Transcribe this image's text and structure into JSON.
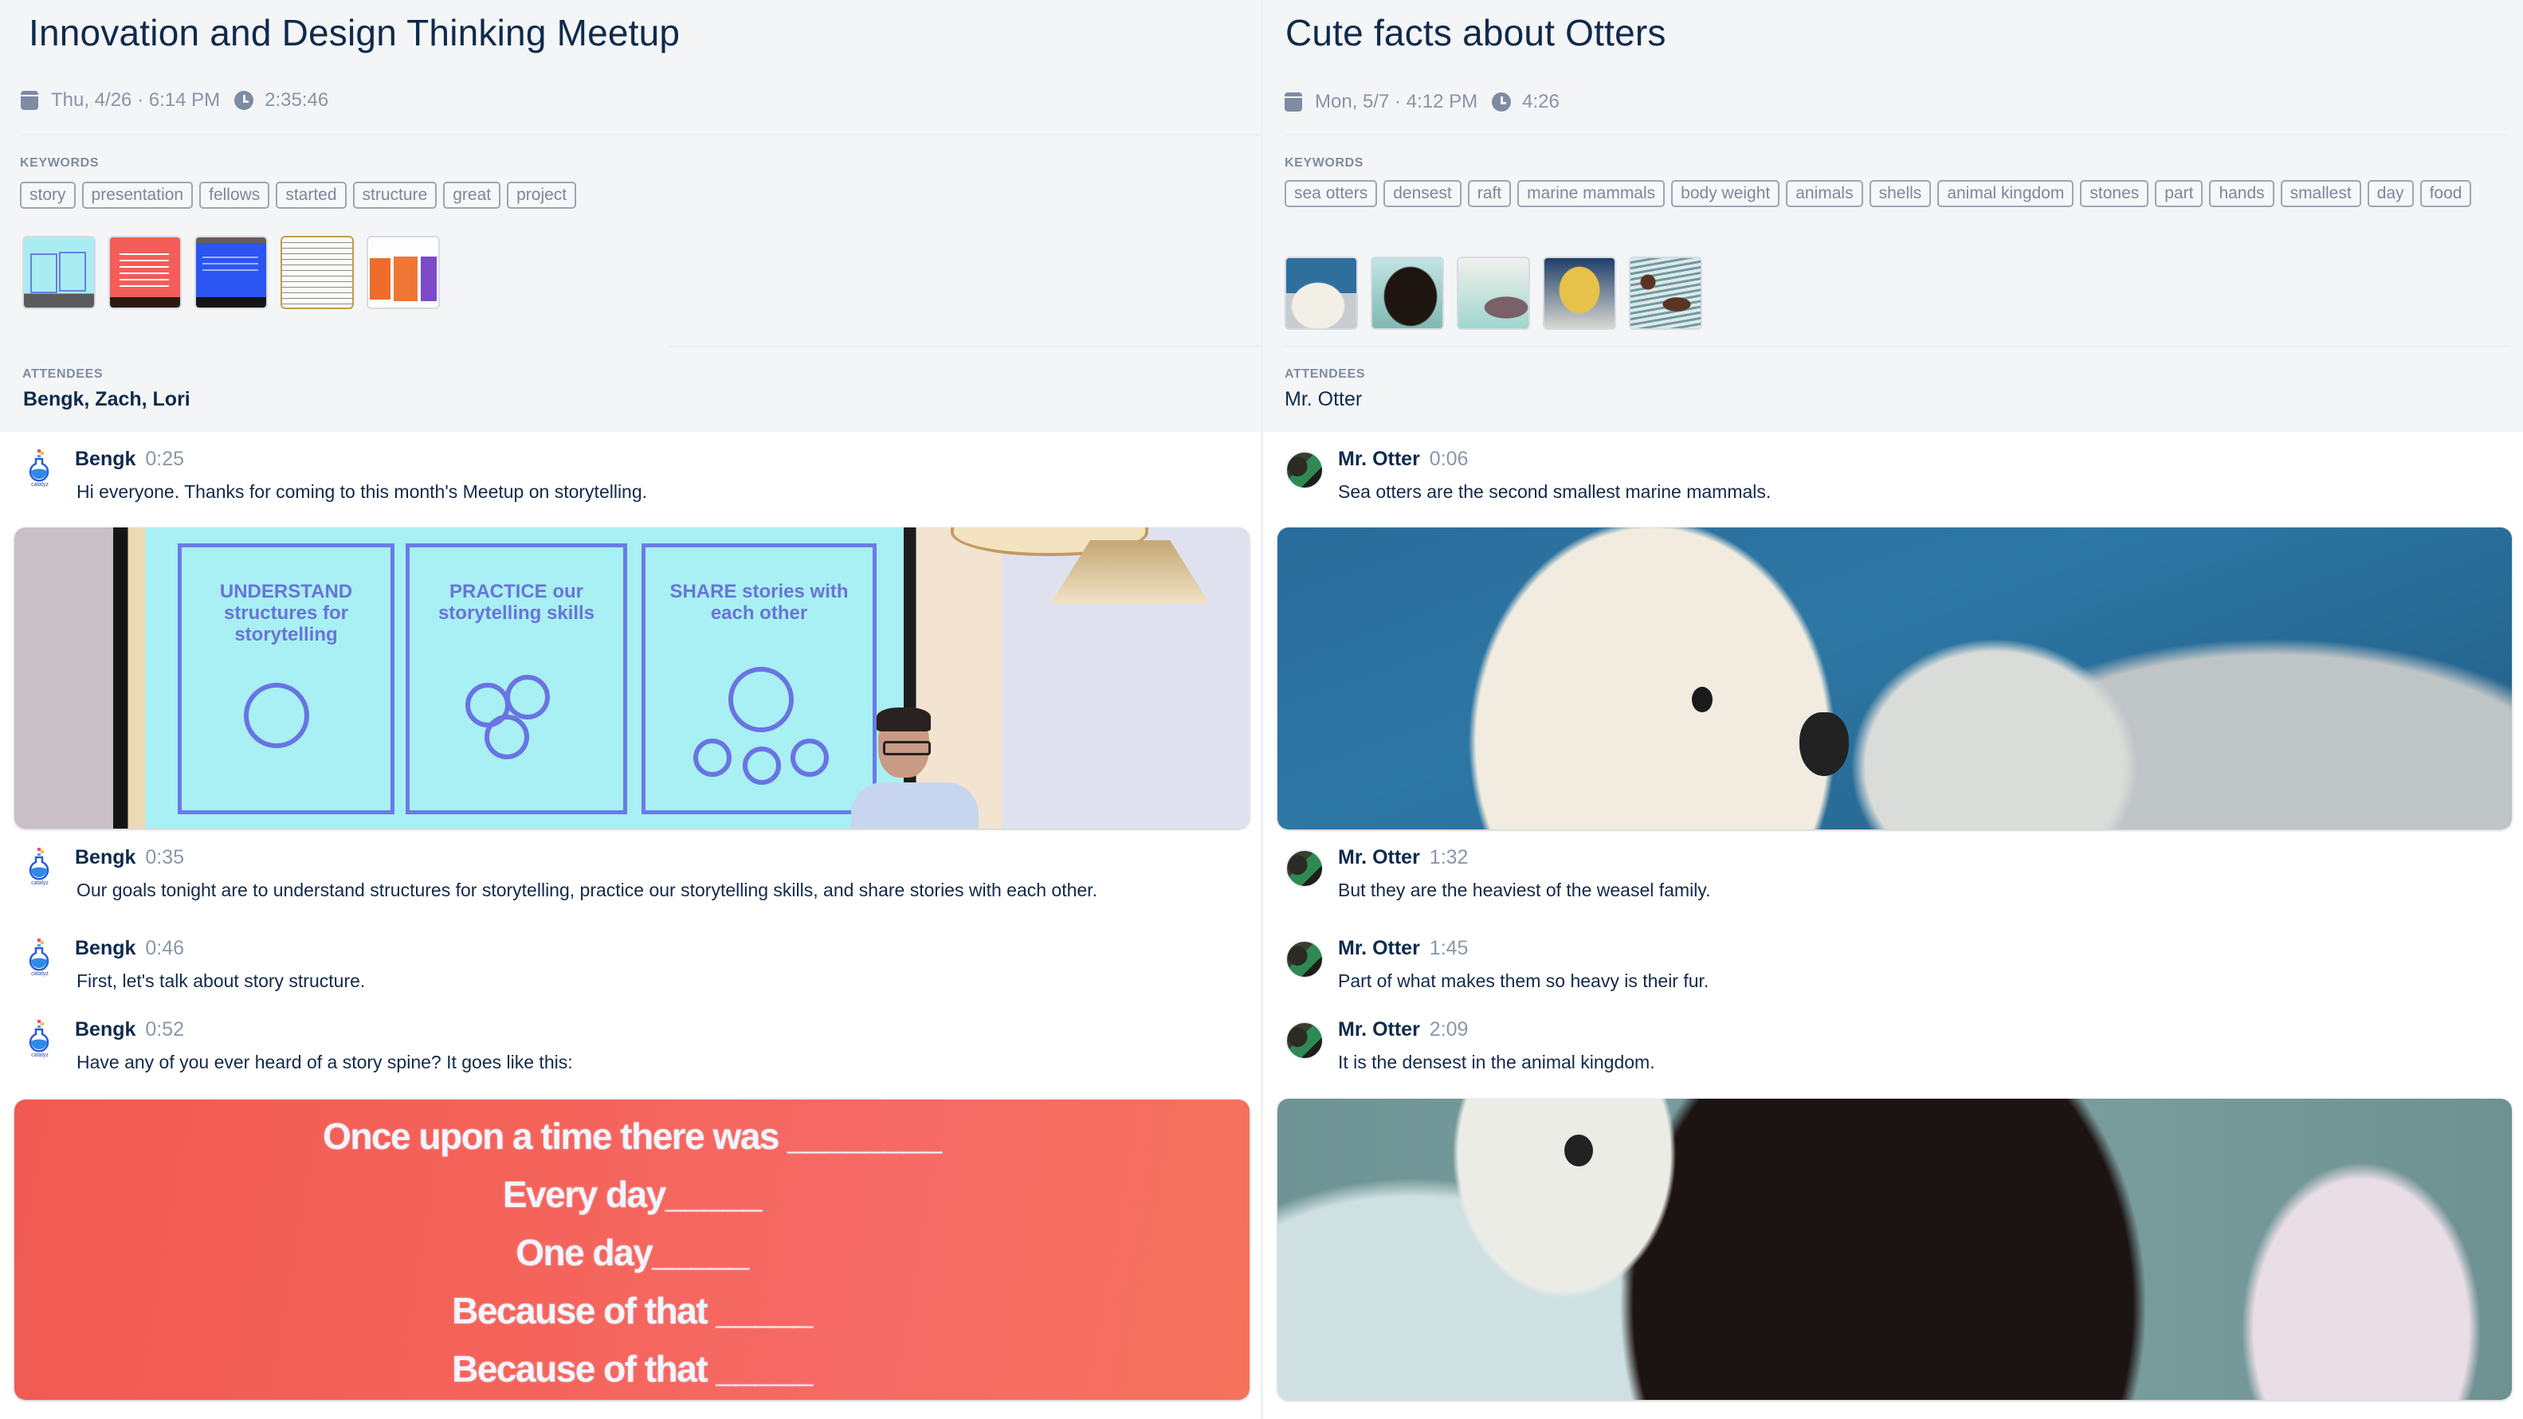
{
  "meetings": [
    {
      "title": "Innovation and Design Thinking Meetup",
      "date": "Thu, 4/26 · 6:14 PM",
      "duration": "2:35:46",
      "keywords_label": "KEYWORDS",
      "keywords": [
        "story",
        "presentation",
        "fellows",
        "started",
        "structure",
        "great",
        "project"
      ],
      "thumbnails": [
        "slide-goals-photo",
        "slide-story-spine-red",
        "slide-warmup-blue",
        "handwritten-story-page",
        "resources-books-slide"
      ],
      "attendees_label": "ATTENDEES",
      "attendees": "Bengk, Zach, Lori",
      "avatar_logo_text": "catalyz",
      "messages": [
        {
          "speaker": "Bengk",
          "time": "0:25",
          "text": "Hi everyone. Thanks for coming to this month's Meetup on storytelling."
        },
        {
          "speaker": "Bengk",
          "time": "0:35",
          "text": "Our goals tonight are to understand structures for storytelling, practice our storytelling skills, and share stories with each other."
        },
        {
          "speaker": "Bengk",
          "time": "0:46",
          "text": "First, let's talk about story structure."
        },
        {
          "speaker": "Bengk",
          "time": "0:52",
          "text": "Have any of you ever heard of a story spine? It goes like this:"
        }
      ],
      "slide_goals": {
        "understand": "UNDERSTAND structures for storytelling",
        "practice": "PRACTICE our storytelling skills",
        "share": "SHARE stories with each other"
      },
      "story_spine_lines": [
        "Once upon a time there was ________",
        "Every day_____",
        "One day_____",
        "Because of that _____",
        "Because of that _____"
      ]
    },
    {
      "title": "Cute facts about Otters",
      "date": "Mon, 5/7 · 4:12 PM",
      "duration": "4:26",
      "keywords_label": "KEYWORDS",
      "keywords": [
        "sea otters",
        "densest",
        "raft",
        "marine mammals",
        "body weight",
        "animals",
        "shells",
        "animal kingdom",
        "stones",
        "part",
        "hands",
        "smallest",
        "day",
        "food"
      ],
      "thumbnails": [
        "otter-white-face",
        "otter-dark-on-rocks",
        "otter-floating",
        "otter-yawning",
        "otters-in-water"
      ],
      "attendees_label": "ATTENDEES",
      "attendees": "Mr. Otter",
      "messages": [
        {
          "speaker": "Mr. Otter",
          "time": "0:06",
          "text": "Sea otters are the second smallest marine mammals."
        },
        {
          "speaker": "Mr. Otter",
          "time": "1:32",
          "text": "But they are the heaviest of the weasel family."
        },
        {
          "speaker": "Mr. Otter",
          "time": "1:45",
          "text": "Part of what makes them so heavy is their fur."
        },
        {
          "speaker": "Mr. Otter",
          "time": "2:09",
          "text": "It is the densest in the animal kingdom."
        }
      ]
    }
  ],
  "colors": {
    "title": "#0e2a4d",
    "muted": "#8794a6",
    "chip_border": "#9aa6b7",
    "header_bg": "#f4f5f7"
  }
}
